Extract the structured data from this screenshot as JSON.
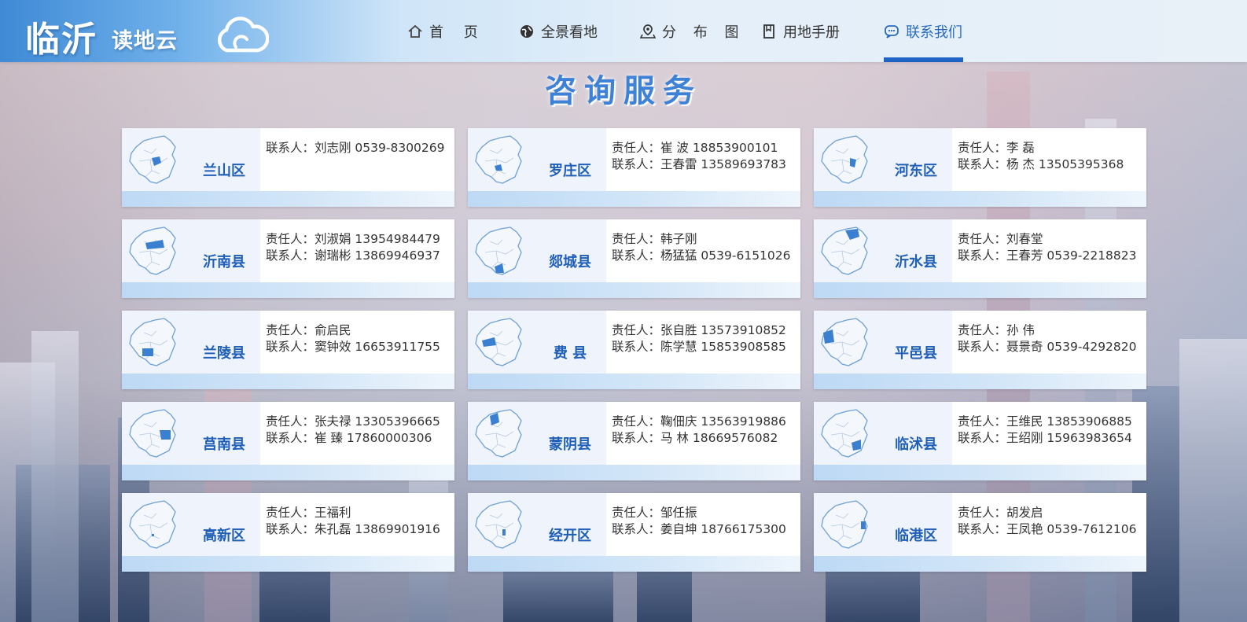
{
  "header": {
    "logo_main": "临沂",
    "logo_sub": "读地云",
    "nav": [
      {
        "label": "首  页",
        "icon": "home-icon",
        "active": false
      },
      {
        "label": "全景看地",
        "icon": "globe-icon",
        "active": false
      },
      {
        "label": "分 布 图",
        "icon": "location-pin-icon",
        "active": false
      },
      {
        "label": "用地手册",
        "icon": "book-icon",
        "active": false
      },
      {
        "label": "联系我们",
        "icon": "chat-icon",
        "active": true
      }
    ]
  },
  "page": {
    "title": "咨询服务"
  },
  "colors": {
    "accent": "#1f63c4",
    "district_text": "#1f5fb8",
    "map_fill": "#3a7fd0"
  },
  "cards": [
    {
      "district": "兰山区",
      "lines": [
        "联系人：刘志刚 0539-8300269"
      ]
    },
    {
      "district": "罗庄区",
      "lines": [
        "责任人：崔 波 18853900101",
        "联系人：王春雷 13589693783"
      ]
    },
    {
      "district": "河东区",
      "lines": [
        "责任人：李 磊",
        "联系人：杨 杰 13505395368"
      ]
    },
    {
      "district": "沂南县",
      "lines": [
        "责任人：刘淑娟 13954984479",
        "联系人：谢瑞彬 13869946937"
      ]
    },
    {
      "district": "郯城县",
      "lines": [
        "责任人：韩子刚",
        "联系人：杨猛猛 0539-6151026"
      ]
    },
    {
      "district": "沂水县",
      "lines": [
        "责任人：刘春堂",
        "联系人：王春芳 0539-2218823"
      ]
    },
    {
      "district": "兰陵县",
      "lines": [
        "责任人：俞启民",
        "联系人：窦钟效 16653911755"
      ]
    },
    {
      "district": "费  县",
      "lines": [
        "责任人：张自胜 13573910852",
        "联系人：陈学慧 15853908585"
      ]
    },
    {
      "district": "平邑县",
      "lines": [
        "责任人：孙 伟",
        "联系人：聂景奇 0539-4292820"
      ]
    },
    {
      "district": "莒南县",
      "lines": [
        "责任人：张夫禄 13305396665",
        "联系人：崔 臻 17860000306"
      ]
    },
    {
      "district": "蒙阴县",
      "lines": [
        "责任人：鞠佃庆 13563919886",
        "联系人：马 林 18669576082"
      ]
    },
    {
      "district": "临沭县",
      "lines": [
        "责任人：王维民 13853906885",
        "联系人：王绍刚 15963983654"
      ]
    },
    {
      "district": "高新区",
      "lines": [
        "责任人：王福利",
        "联系人：朱孔磊 13869901916"
      ]
    },
    {
      "district": "经开区",
      "lines": [
        "责任人：邹任振",
        "联系人：姜自坤 18766175300"
      ]
    },
    {
      "district": "临港区",
      "lines": [
        "责任人：胡发启",
        "联系人：王凤艳 0539-7612106"
      ]
    }
  ]
}
